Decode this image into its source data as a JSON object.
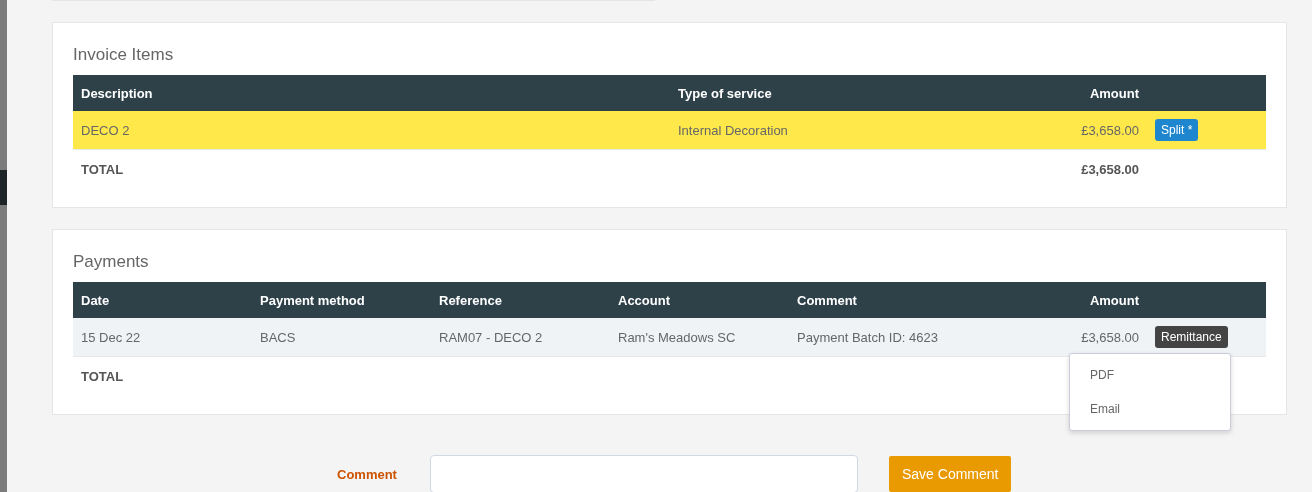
{
  "invoice_items": {
    "title": "Invoice Items",
    "columns": [
      {
        "label": "Description",
        "kind": "text"
      },
      {
        "label": "Type of service",
        "kind": "text"
      },
      {
        "label": "Amount",
        "kind": "amount"
      }
    ],
    "rows": [
      {
        "cells": [
          "DECO 2",
          "Internal Decoration",
          "£3,658.00"
        ],
        "highlighted": true,
        "action": {
          "label": "Split *",
          "kind": "split"
        }
      }
    ],
    "total": {
      "label": "TOTAL",
      "amount": "£3,658.00"
    }
  },
  "payments": {
    "title": "Payments",
    "columns": [
      {
        "label": "Date",
        "kind": "text"
      },
      {
        "label": "Payment method",
        "kind": "text"
      },
      {
        "label": "Reference",
        "kind": "text"
      },
      {
        "label": "Account",
        "kind": "text"
      },
      {
        "label": "Comment",
        "kind": "text"
      },
      {
        "label": "Amount",
        "kind": "amount"
      }
    ],
    "rows": [
      {
        "cells": [
          "15 Dec 22",
          "BACS",
          "RAM07 - DECO 2",
          "Ram's Meadows SC",
          "Payment Batch ID: 4623",
          "£3,658.00"
        ],
        "highlighted": false,
        "action": {
          "label": "Remittance",
          "kind": "remittance",
          "expanded": true,
          "menu": [
            "PDF",
            "Email"
          ]
        }
      }
    ],
    "total": {
      "label": "TOTAL"
    }
  },
  "comment_form": {
    "label": "Comment",
    "button": "Save Comment"
  }
}
